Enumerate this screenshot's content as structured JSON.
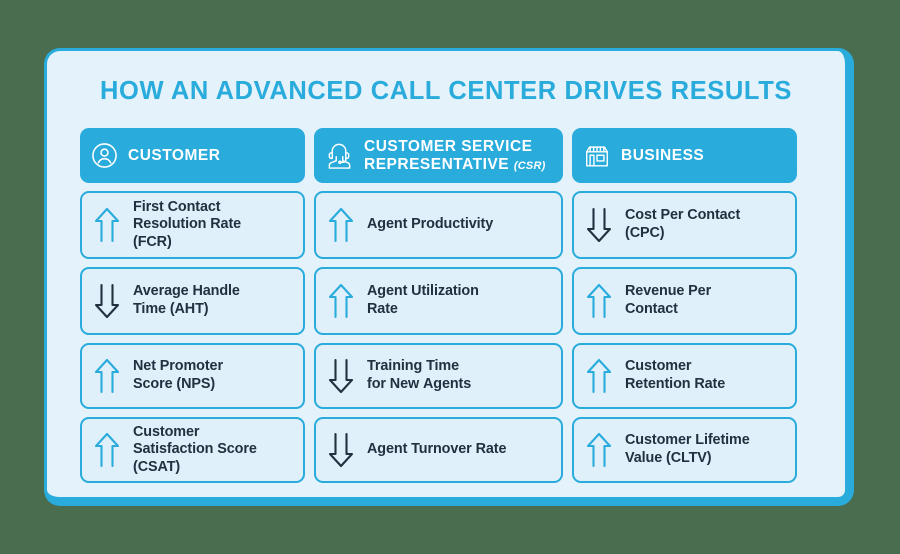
{
  "title": "HOW AN ADVANCED CALL CENTER DRIVES RESULTS",
  "colors": {
    "page_background": "#4a6c4f",
    "panel_background": "#e3f2fb",
    "accent_blue": "#29abdc",
    "card_background": "#dff0fb",
    "up_arrow": "#29abdc",
    "down_arrow": "#23303f",
    "text_dark": "#23303f",
    "header_text": "#ffffff"
  },
  "columns": [
    {
      "header": {
        "label": "CUSTOMER",
        "sub": "",
        "icon": "customer-person-circle-icon"
      },
      "cards": [
        {
          "direction": "up",
          "arrow_icon": "arrow-up-icon",
          "label": "First Contact\nResolution Rate\n(FCR)"
        },
        {
          "direction": "down",
          "arrow_icon": "arrow-down-icon",
          "label": "Average Handle\nTime (AHT)"
        },
        {
          "direction": "up",
          "arrow_icon": "arrow-up-icon",
          "label": "Net Promoter\nScore (NPS)"
        },
        {
          "direction": "up",
          "arrow_icon": "arrow-up-icon",
          "label": "Customer\nSatisfaction Score\n(CSAT)"
        }
      ]
    },
    {
      "header": {
        "label": "CUSTOMER SERVICE\nREPRESENTATIVE",
        "sub": "(CSR)",
        "icon": "headset-agent-icon"
      },
      "cards": [
        {
          "direction": "up",
          "arrow_icon": "arrow-up-icon",
          "label": "Agent Productivity"
        },
        {
          "direction": "up",
          "arrow_icon": "arrow-up-icon",
          "label": "Agent Utilization\nRate"
        },
        {
          "direction": "down",
          "arrow_icon": "arrow-down-icon",
          "label": "Training Time\nfor New Agents"
        },
        {
          "direction": "down",
          "arrow_icon": "arrow-down-icon",
          "label": "Agent Turnover Rate"
        }
      ]
    },
    {
      "header": {
        "label": "BUSINESS",
        "sub": "",
        "icon": "storefront-icon"
      },
      "cards": [
        {
          "direction": "down",
          "arrow_icon": "arrow-down-icon",
          "label": "Cost Per Contact\n(CPC)"
        },
        {
          "direction": "up",
          "arrow_icon": "arrow-up-icon",
          "label": "Revenue Per\nContact"
        },
        {
          "direction": "up",
          "arrow_icon": "arrow-up-icon",
          "label": "Customer\nRetention Rate"
        },
        {
          "direction": "up",
          "arrow_icon": "arrow-up-icon",
          "label": "Customer Lifetime\nValue (CLTV)"
        }
      ]
    }
  ]
}
